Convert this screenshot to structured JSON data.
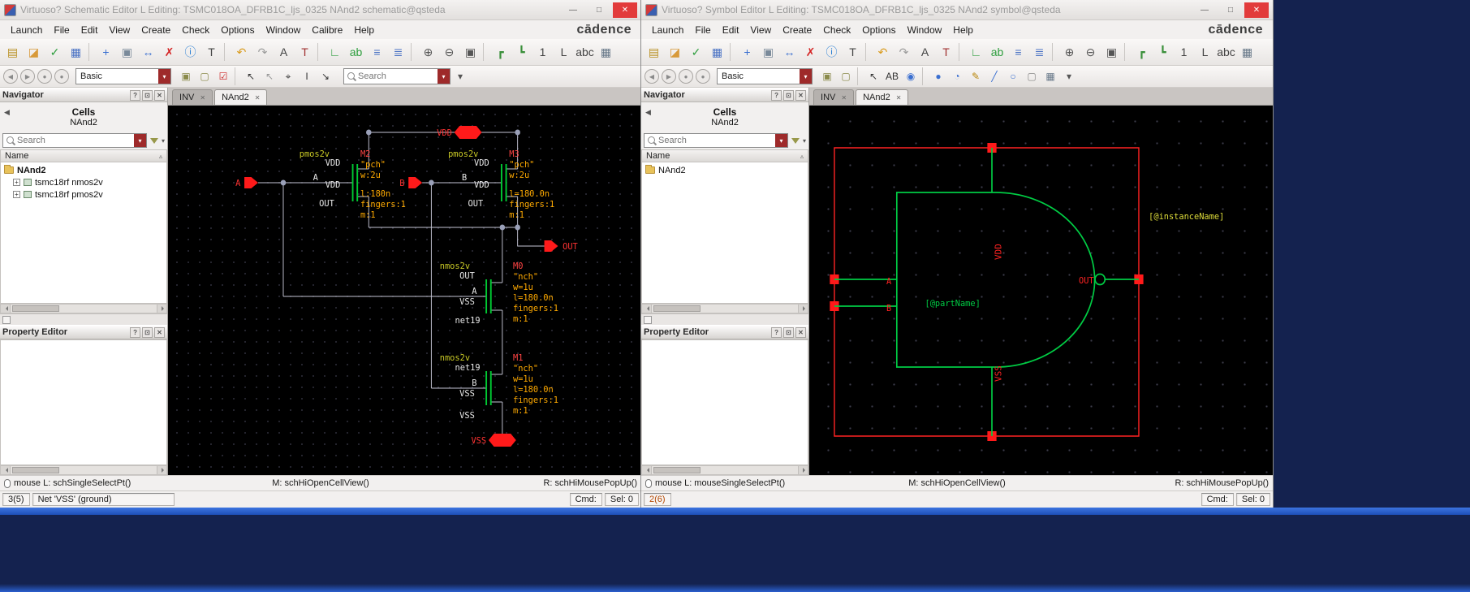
{
  "shared": {
    "logo": "cādence",
    "search_placeholder": "Search",
    "navigator_title": "Navigator",
    "property_editor_title": "Property Editor",
    "cells_label": "Cells",
    "name_header": "Name",
    "status_mid": "M: schHiOpenCellView()",
    "status_right": "R: schHiMousePopUp()",
    "cmd_label": "Cmd:",
    "sel_label": "Sel: 0",
    "tabs": [
      {
        "label": "INV",
        "state": ""
      },
      {
        "label": "NAnd2",
        "state": "active"
      }
    ]
  },
  "icons": {
    "minimize": "—",
    "maximize": "□",
    "close": "✕",
    "help": "?",
    "float": "⊡",
    "dropdown": "▾",
    "back": "◀",
    "sort": "▵",
    "expander": "+"
  },
  "tb1": [
    {
      "name": "new-file-icon",
      "glyph": "▤",
      "color": "#b99022"
    },
    {
      "name": "open-icon",
      "glyph": "◪",
      "color": "#d89a3a"
    },
    {
      "name": "check-save-icon",
      "glyph": "✓",
      "color": "#2e9e3e"
    },
    {
      "name": "save-icon",
      "glyph": "▦",
      "color": "#4a72c4"
    },
    {
      "cls": "sep",
      "name": "toolbar-separator"
    },
    {
      "name": "move-icon",
      "glyph": "+",
      "color": "#3a6fd0"
    },
    {
      "name": "copy-icon",
      "glyph": "▣",
      "color": "#7a8a9a"
    },
    {
      "name": "stretch-icon",
      "glyph": "↔",
      "color": "#3a6fd0"
    },
    {
      "name": "delete-icon",
      "glyph": "✗",
      "color": "#d42222"
    },
    {
      "name": "info-icon",
      "glyph": "ⓘ",
      "color": "#2a7fd4"
    },
    {
      "name": "edit-text-icon",
      "glyph": "T",
      "color": "#444444"
    },
    {
      "cls": "sep",
      "name": "toolbar-separator"
    },
    {
      "name": "undo-icon",
      "glyph": "↶",
      "color": "#d99a1a"
    },
    {
      "name": "redo-icon",
      "glyph": "↷",
      "color": "#9a9a9a"
    },
    {
      "name": "font-icon",
      "glyph": "A",
      "color": "#444444"
    },
    {
      "name": "label-icon",
      "glyph": "T",
      "color": "#a03030"
    },
    {
      "cls": "sep",
      "name": "toolbar-separator"
    },
    {
      "name": "wire-icon",
      "glyph": "∟",
      "color": "#2e9e3e"
    },
    {
      "name": "wire-name-icon",
      "glyph": "ab",
      "color": "#2e9e3e"
    },
    {
      "name": "align-icon",
      "glyph": "≡",
      "color": "#4a72c4"
    },
    {
      "name": "distribute-icon",
      "glyph": "≣",
      "color": "#4a72c4"
    },
    {
      "cls": "sep",
      "name": "toolbar-separator"
    },
    {
      "name": "zoom-in-icon",
      "glyph": "⊕",
      "color": "#555555"
    },
    {
      "name": "zoom-out-icon",
      "glyph": "⊖",
      "color": "#555555"
    },
    {
      "name": "zoom-fit-icon",
      "glyph": "▣",
      "color": "#555555"
    },
    {
      "cls": "sep",
      "name": "toolbar-separator"
    },
    {
      "name": "route-icon",
      "glyph": "┏",
      "color": "#3a8f3a"
    },
    {
      "name": "route-flight-icon",
      "glyph": "┗",
      "color": "#3a8f3a"
    },
    {
      "name": "descend-icon",
      "glyph": "1",
      "color": "#444444"
    },
    {
      "name": "ascend-icon",
      "glyph": "L",
      "color": "#444444"
    },
    {
      "name": "abc-icon",
      "glyph": "abc",
      "color": "#444444"
    },
    {
      "name": "browser-icon",
      "glyph": "▦",
      "color": "#667788"
    }
  ],
  "tb2_nav": [
    {
      "cls": "circ",
      "name": "prev-view-icon",
      "glyph": "◀",
      "color": "#8a8a8a"
    },
    {
      "cls": "circ",
      "name": "next-view-icon",
      "glyph": "▶",
      "color": "#8a8a8a"
    },
    {
      "cls": "circ",
      "name": "prev-zoom-icon",
      "glyph": "●",
      "color": "#8a8a8a"
    },
    {
      "cls": "circ",
      "name": "next-zoom-icon",
      "glyph": "●",
      "color": "#8a8a8a"
    }
  ],
  "tb2_left": [
    {
      "name": "layer-icon",
      "glyph": "▣",
      "color": "#8a8a4a"
    },
    {
      "name": "layer-alt-icon",
      "glyph": "▢",
      "color": "#8a8a4a"
    },
    {
      "name": "filter-check-icon",
      "glyph": "☑",
      "color": "#cc2020"
    },
    {
      "cls": "sep",
      "name": "toolbar-separator"
    },
    {
      "name": "select-cursor-icon",
      "glyph": "↖",
      "color": "#333333"
    },
    {
      "name": "partial-cursor-icon",
      "glyph": "↖",
      "color": "#999999"
    },
    {
      "name": "probe-cursor-icon",
      "glyph": "⌖",
      "color": "#333333"
    },
    {
      "name": "text-cursor-icon",
      "glyph": "I",
      "color": "#333333"
    },
    {
      "name": "stretch-cursor-icon",
      "glyph": "↘",
      "color": "#333333"
    }
  ],
  "tb2_right": [
    {
      "name": "layer-icon",
      "glyph": "▣",
      "color": "#8a8a4a"
    },
    {
      "name": "layer-alt-icon",
      "glyph": "▢",
      "color": "#8a8a4a"
    },
    {
      "cls": "sep",
      "name": "toolbar-separator"
    },
    {
      "name": "select-cursor-icon",
      "glyph": "↖",
      "color": "#333333"
    },
    {
      "name": "abc-label-icon",
      "glyph": "AB",
      "color": "#333333"
    },
    {
      "name": "pin-icon",
      "glyph": "◉",
      "color": "#3a6fd0"
    },
    {
      "cls": "sep",
      "name": "toolbar-separator"
    },
    {
      "name": "filled-ellipse-icon",
      "glyph": "●",
      "color": "#3a6fd0"
    },
    {
      "name": "arc-icon",
      "glyph": "◔",
      "color": "#3a6fd0"
    },
    {
      "name": "pencil-icon",
      "glyph": "✎",
      "color": "#b8860b"
    },
    {
      "name": "line-icon",
      "glyph": "╱",
      "color": "#3a6fd0"
    },
    {
      "name": "ellipse-icon",
      "glyph": "○",
      "color": "#3a6fd0"
    },
    {
      "name": "sheet-icon",
      "glyph": "▢",
      "color": "#888888"
    },
    {
      "name": "table-icon",
      "glyph": "▦",
      "color": "#667788"
    }
  ],
  "left": {
    "title": "Virtuoso? Schematic Editor L Editing: TSMC018OA_DFRB1C_ljs_0325 NAnd2 schematic@qsteda",
    "menus": [
      "Launch",
      "File",
      "Edit",
      "View",
      "Create",
      "Check",
      "Options",
      "Window",
      "Calibre",
      "Help"
    ],
    "workspace": "Basic",
    "cell": "NAnd2",
    "tree": {
      "root": "NAnd2",
      "children": [
        "tsmc18rf nmos2v",
        "tsmc18rf pmos2v"
      ]
    },
    "status_left": "mouse L: schSingleSelectPt()",
    "counter": "3(5)",
    "net_status": "Net 'VSS' (ground)",
    "schematic": {
      "net_vdd": "VDD",
      "net_vss": "VSS",
      "pin_a": "A",
      "pin_b": "B",
      "pin_out": "OUT",
      "m2": {
        "type": "pmos2v",
        "name": "M2",
        "model": "\"pch\"",
        "w": "w:2u",
        "l": "l:180n",
        "fingers": "fingers:1",
        "mult": "m:1",
        "src": "VDD",
        "gate": "A",
        "bulk": "VDD",
        "drain": "OUT"
      },
      "m3": {
        "type": "pmos2v",
        "name": "M3",
        "model": "\"pch\"",
        "w": "w:2u",
        "l": "l=180.0n",
        "fingers": "fingers:1",
        "mult": "m:1",
        "src": "VDD",
        "gate": "B",
        "bulk": "VDD",
        "drain": "OUT"
      },
      "m0": {
        "type": "nmos2v",
        "name": "M0",
        "model": "\"nch\"",
        "w": "w=1u",
        "l": "l=180.0n",
        "fingers": "fingers:1",
        "mult": "m:1",
        "drain": "OUT",
        "gate": "A",
        "bulk": "VSS",
        "src": "net19"
      },
      "m1": {
        "type": "nmos2v",
        "name": "M1",
        "model": "\"nch\"",
        "w": "w=1u",
        "l": "l=180.0n",
        "fingers": "fingers:1",
        "mult": "m:1",
        "drain": "net19",
        "gate": "B",
        "bulk": "VSS",
        "src": "VSS"
      }
    }
  },
  "right": {
    "title": "Virtuoso? Symbol Editor L Editing: TSMC018OA_DFRB1C_ljs_0325 NAnd2 symbol@qsteda",
    "menus": [
      "Launch",
      "File",
      "Edit",
      "View",
      "Create",
      "Check",
      "Options",
      "Window",
      "Help"
    ],
    "workspace": "Basic",
    "cell": "NAnd2",
    "tree": {
      "root": "NAnd2"
    },
    "status_left": "mouse L: mouseSingleSelectPt()",
    "counter": "2(6)",
    "symbol": {
      "instance_label": "[@instanceName]",
      "part_label": "[@partName]",
      "pin_a": "A",
      "pin_b": "B",
      "pin_out": "OUT",
      "net_vdd": "VDD",
      "net_vss": "VSS"
    }
  }
}
